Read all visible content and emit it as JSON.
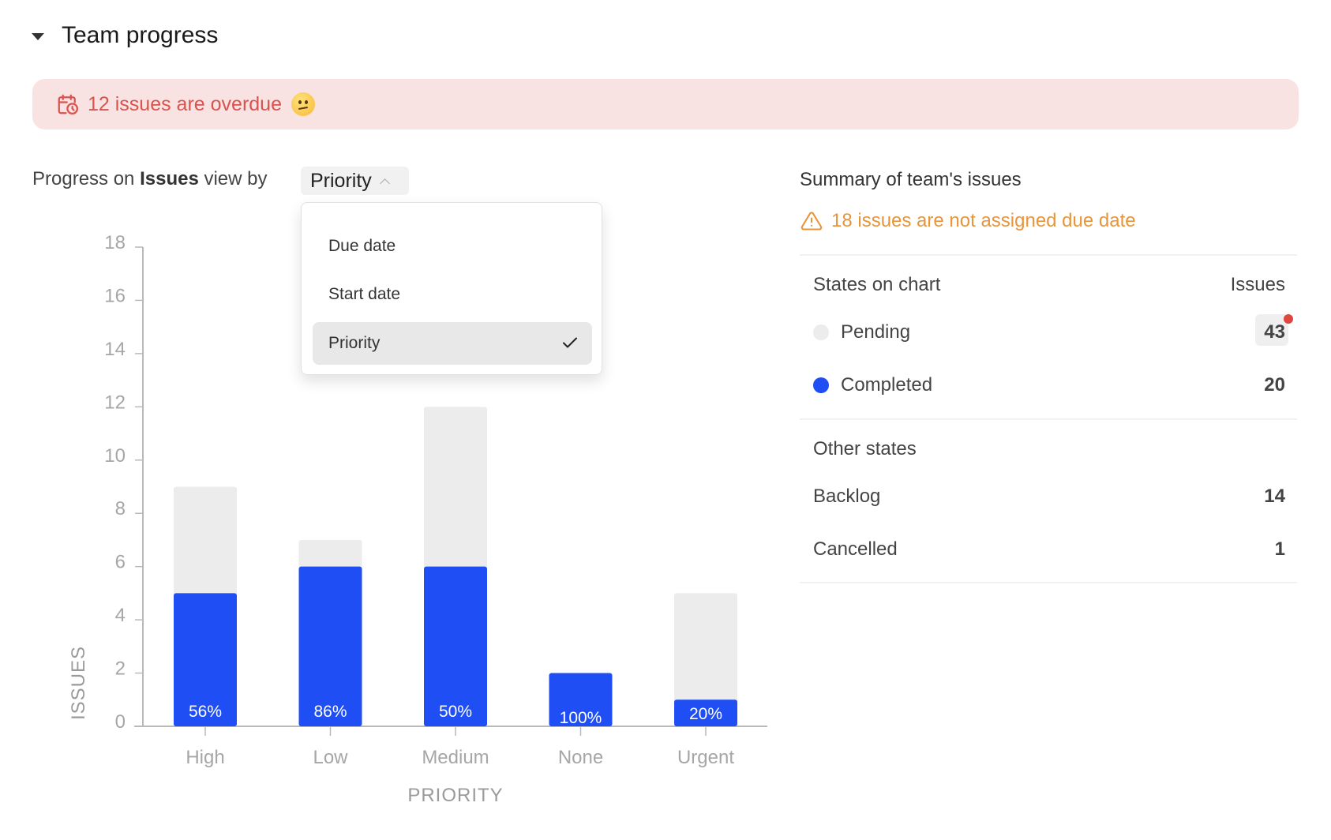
{
  "section": {
    "title": "Team progress",
    "collapse_icon": "caret-down-icon"
  },
  "overdue_banner": {
    "icon": "calendar-clock-icon",
    "text": "12 issues are overdue",
    "emoji": "confused-face-emoji",
    "bg_color": "#f9e3e2",
    "text_color": "#d9534f"
  },
  "progress_header": {
    "prefix": "Progress on ",
    "entity": "Issues",
    "suffix": " view by",
    "selected_view": "Priority",
    "chevron_icon": "chevron-up-icon"
  },
  "view_dropdown": {
    "options": [
      {
        "label": "Due date",
        "selected": false
      },
      {
        "label": "Start date",
        "selected": false
      },
      {
        "label": "Priority",
        "selected": true
      }
    ],
    "check_icon": "check-icon"
  },
  "summary": {
    "title": "Summary of team's issues",
    "warning_icon": "warning-triangle-icon",
    "warning_text": "18 issues are not assigned due date",
    "warning_color": "#e8953a",
    "states_on_chart_label": "States on chart",
    "issues_column_label": "Issues",
    "chart_states": [
      {
        "name": "Pending",
        "count": "43",
        "color": "#ececec",
        "has_notification": true
      },
      {
        "name": "Completed",
        "count": "20",
        "color": "#1f4ef5"
      }
    ],
    "other_states_label": "Other states",
    "other_states": [
      {
        "name": "Backlog",
        "count": "14"
      },
      {
        "name": "Cancelled",
        "count": "1"
      }
    ]
  },
  "chart_data": {
    "type": "bar",
    "stacked": true,
    "title": "",
    "xlabel": "PRIORITY",
    "ylabel": "ISSUES",
    "categories": [
      "High",
      "Low",
      "Medium",
      "None",
      "Urgent"
    ],
    "series": [
      {
        "name": "Completed",
        "color": "#1f4ef5",
        "values": [
          5,
          6,
          6,
          2,
          1
        ]
      },
      {
        "name": "Pending",
        "color": "#ececec",
        "values": [
          4,
          1,
          6,
          0,
          4
        ]
      }
    ],
    "totals": [
      9,
      7,
      12,
      2,
      5
    ],
    "data_labels": [
      "56%",
      "86%",
      "50%",
      "100%",
      "20%"
    ],
    "yticks": [
      0,
      2,
      4,
      6,
      8,
      10,
      12,
      14,
      16,
      18
    ],
    "ylim": [
      0,
      18
    ],
    "grid": false
  }
}
